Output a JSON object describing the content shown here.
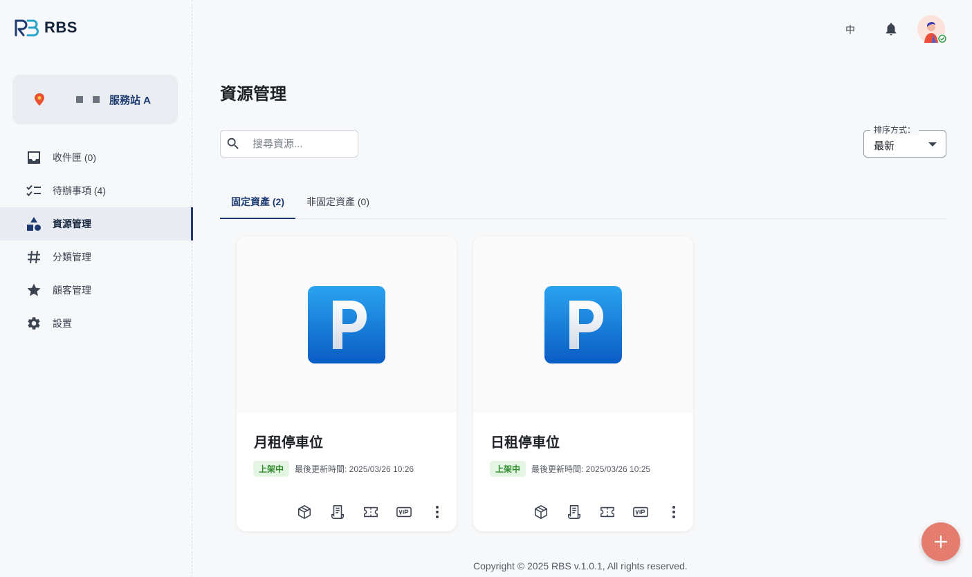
{
  "app": {
    "name": "RBS"
  },
  "station": {
    "name": "服務站 A"
  },
  "nav": [
    {
      "label": "收件匣 (0)",
      "icon": "inbox-icon",
      "active": false
    },
    {
      "label": "待辦事項 (4)",
      "icon": "checklist-icon",
      "active": false
    },
    {
      "label": "資源管理",
      "icon": "shapes-icon",
      "active": true
    },
    {
      "label": "分類管理",
      "icon": "hashtag-icon",
      "active": false
    },
    {
      "label": "顧客管理",
      "icon": "star-icon",
      "active": false
    },
    {
      "label": "設置",
      "icon": "gear-icon",
      "active": false
    }
  ],
  "topbar": {
    "language": "中"
  },
  "main": {
    "title": "資源管理",
    "search": {
      "placeholder": "搜尋資源...",
      "value": ""
    },
    "sort": {
      "label": "排序方式：",
      "value": "最新"
    },
    "tabs": [
      {
        "label": "固定資產 (2)",
        "active": true
      },
      {
        "label": "非固定資產 (0)",
        "active": false
      }
    ],
    "cards": [
      {
        "title": "月租停車位",
        "status": "上架中",
        "updated": "最後更新時間: 2025/03/26 10:26",
        "image": "parking-sign-icon"
      },
      {
        "title": "日租停車位",
        "status": "上架中",
        "updated": "最後更新時間: 2025/03/26 10:25",
        "image": "parking-sign-icon"
      }
    ]
  },
  "footer": {
    "text": "Copyright © 2025 RBS v.1.0.1, All rights reserved."
  },
  "colors": {
    "primary": "#1d3b70",
    "accent": "#e57d6f",
    "status_green": "#2f8a2c"
  }
}
